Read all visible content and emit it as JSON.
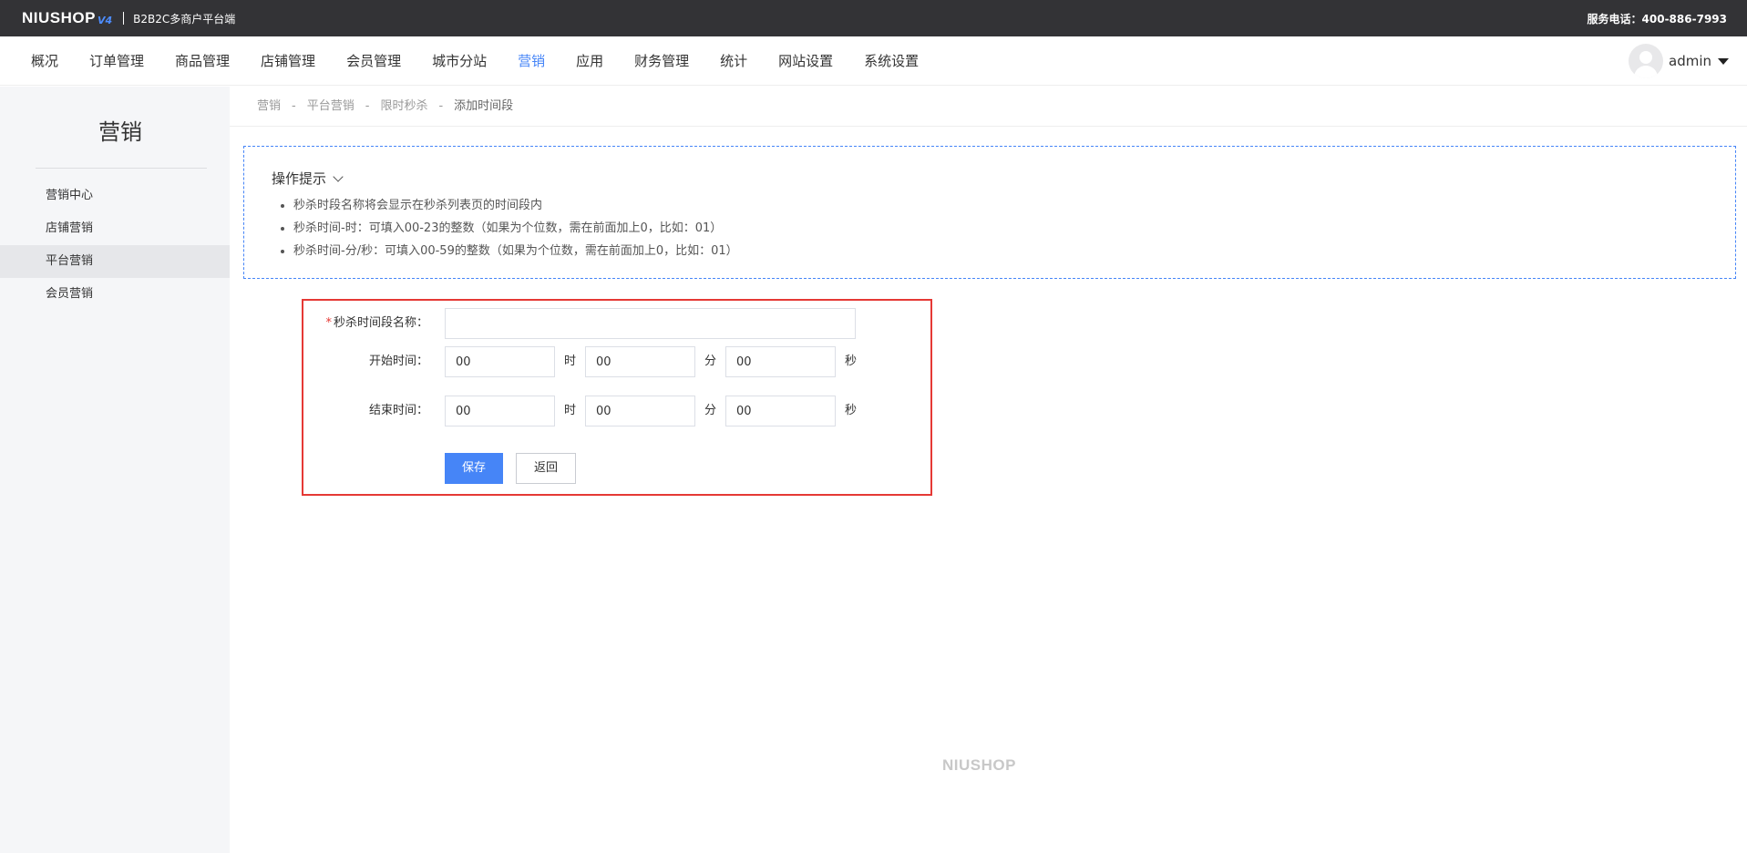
{
  "topbar": {
    "logo_text": "NIUSHOP",
    "logo_version": "V4",
    "subtitle": "B2B2C多商户平台端",
    "hotline": "服务电话：400-886-7993"
  },
  "nav": {
    "items": [
      {
        "label": "概况"
      },
      {
        "label": "订单管理"
      },
      {
        "label": "商品管理"
      },
      {
        "label": "店铺管理"
      },
      {
        "label": "会员管理"
      },
      {
        "label": "城市分站"
      },
      {
        "label": "营销",
        "active": true
      },
      {
        "label": "应用"
      },
      {
        "label": "财务管理"
      },
      {
        "label": "统计"
      },
      {
        "label": "网站设置"
      },
      {
        "label": "系统设置"
      }
    ],
    "user_name": "admin"
  },
  "sidebar": {
    "title": "营销",
    "items": [
      {
        "label": "营销中心"
      },
      {
        "label": "店铺营销"
      },
      {
        "label": "平台营销",
        "active": true
      },
      {
        "label": "会员营销"
      }
    ]
  },
  "breadcrumb": {
    "items": [
      "营销",
      "平台营销",
      "限时秒杀"
    ],
    "current": "添加时间段",
    "separator": "-"
  },
  "tips": {
    "title": "操作提示",
    "lines": [
      "秒杀时段名称将会显示在秒杀列表页的时间段内",
      "秒杀时间-时：可填入00-23的整数（如果为个位数，需在前面加上0，比如：01）",
      "秒杀时间-分/秒：可填入00-59的整数（如果为个位数，需在前面加上0，比如：01）"
    ]
  },
  "form": {
    "name_label": "秒杀时间段名称：",
    "required_mark": "*",
    "name_value": "",
    "start_label": "开始时间：",
    "end_label": "结束时间：",
    "start": {
      "hour": "00",
      "minute": "00",
      "second": "00"
    },
    "end": {
      "hour": "00",
      "minute": "00",
      "second": "00"
    },
    "unit_hour": "时",
    "unit_minute": "分",
    "unit_second": "秒",
    "save_label": "保存",
    "back_label": "返回"
  },
  "footer": {
    "logo_text": "NIUSHOP"
  },
  "colors": {
    "accent": "#4685f7",
    "highlight_border": "#e53935",
    "topbar_bg": "#333336"
  }
}
